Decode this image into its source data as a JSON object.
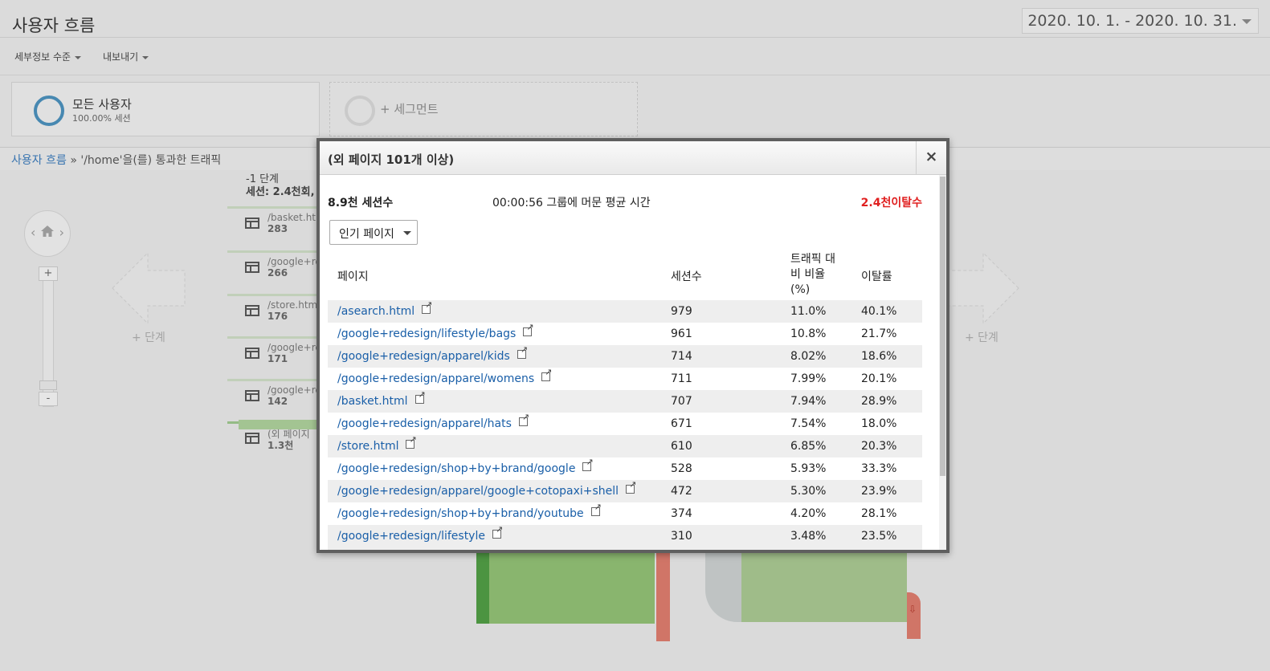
{
  "page": {
    "title": "사용자 흐름",
    "date_range": "2020. 10. 1. - 2020. 10. 31."
  },
  "toolbar": {
    "detail_level": "세부정보 수준",
    "export": "내보내기"
  },
  "segments": {
    "all_users_title": "모든 사용자",
    "all_users_sub": "100.00% 세션",
    "add_segment": "+ 세그먼트"
  },
  "breadcrumb": {
    "root": "사용자 흐름",
    "separator": "»",
    "current": "'/home'을(를) 통과한 트래픽"
  },
  "flow": {
    "add_step_left": "+ 단계",
    "add_step_right": "+ 단계",
    "step_title": "-1 단계",
    "step_sub": "세션: 2.4천회,",
    "nodes": [
      {
        "label": "/basket.htm",
        "count": "283"
      },
      {
        "label": "/google+re",
        "count": "266"
      },
      {
        "label": "/store.htm",
        "count": "176"
      },
      {
        "label": "/google+re",
        "count": "171"
      },
      {
        "label": "/google+re",
        "count": "142"
      },
      {
        "label": "(외 페이지",
        "count": "1.3천"
      }
    ],
    "zoom_in": "+",
    "zoom_out": "-"
  },
  "modal": {
    "title": "(외 페이지 101개 이상)",
    "close": "×",
    "sessions": "8.9천 세션수",
    "avg_time": "00:00:56 그룹에 머문 평균 시간",
    "exits": "2.4천이탈수",
    "dropdown_value": "인기 페이지",
    "columns": {
      "page": "페이지",
      "sessions": "세션수",
      "traffic_share": "트래픽 대비 비율 (%)",
      "exit_rate": "이탈률"
    },
    "rows": [
      {
        "page": "/asearch.html",
        "sessions": "979",
        "pct": "11.0%",
        "exit": "40.1%"
      },
      {
        "page": "/google+redesign/lifestyle/bags",
        "sessions": "961",
        "pct": "10.8%",
        "exit": "21.7%"
      },
      {
        "page": "/google+redesign/apparel/kids",
        "sessions": "714",
        "pct": "8.02%",
        "exit": "18.6%"
      },
      {
        "page": "/google+redesign/apparel/womens",
        "sessions": "711",
        "pct": "7.99%",
        "exit": "20.1%"
      },
      {
        "page": "/basket.html",
        "sessions": "707",
        "pct": "7.94%",
        "exit": "28.9%"
      },
      {
        "page": "/google+redesign/apparel/hats",
        "sessions": "671",
        "pct": "7.54%",
        "exit": "18.0%"
      },
      {
        "page": "/store.html",
        "sessions": "610",
        "pct": "6.85%",
        "exit": "20.3%"
      },
      {
        "page": "/google+redesign/shop+by+brand/google",
        "sessions": "528",
        "pct": "5.93%",
        "exit": "33.3%"
      },
      {
        "page": "/google+redesign/apparel/google+cotopaxi+shell",
        "sessions": "472",
        "pct": "5.30%",
        "exit": "23.9%"
      },
      {
        "page": "/google+redesign/shop+by+brand/youtube",
        "sessions": "374",
        "pct": "4.20%",
        "exit": "28.1%"
      },
      {
        "page": "/google+redesign/lifestyle",
        "sessions": "310",
        "pct": "3.48%",
        "exit": "23.5%"
      }
    ]
  },
  "colors": {
    "link": "#1a5fa8",
    "exit_red": "#e02020",
    "accent_blue": "#4a8db8",
    "flow_green": "#8fbc73"
  }
}
